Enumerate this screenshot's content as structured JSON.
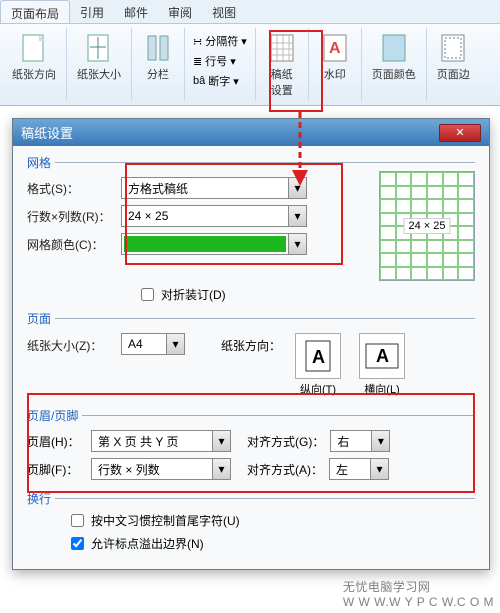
{
  "ribbon": {
    "tabs": [
      "页面布局",
      "引用",
      "邮件",
      "审阅",
      "视图"
    ],
    "active_tab": 0,
    "tools": {
      "paper_dir": "纸张方向",
      "paper_size": "纸张大小",
      "columns": "分栏",
      "breaks": "分隔符",
      "line_num": "行号",
      "hyphen": "断字",
      "manuscript": "稿纸",
      "manuscript_sub": "设置",
      "watermark": "水印",
      "page_color": "页面颜色",
      "page_border": "页面边"
    }
  },
  "dialog": {
    "title": "稿纸设置",
    "grid_section": "网格",
    "format_label": "格式(S)：",
    "format_value": "方格式稿纸",
    "rowcol_label": "行数×列数(R)：",
    "rowcol_value": "24 × 25",
    "gridcolor_label": "网格颜色(C)：",
    "preview_label": "24 × 25",
    "fold_label": "对折装订(D)",
    "page_section": "页面",
    "papersize_label": "纸张大小(Z)：",
    "papersize_value": "A4",
    "paperdir_label": "纸张方向：",
    "portrait": "纵向(T)",
    "landscape": "横向(L)",
    "hf_section": "页眉/页脚",
    "header_label": "页眉(H)：",
    "header_value": "第 X 页 共 Y 页",
    "header_align_label": "对齐方式(G)：",
    "header_align_value": "右",
    "footer_label": "页脚(F)：",
    "footer_value": "行数 × 列数",
    "footer_align_label": "对齐方式(A)：",
    "footer_align_value": "左",
    "wrap_section": "换行",
    "cjk_label": "按中文习惯控制首尾字符(U)",
    "punct_label": "允许标点溢出边界(N)"
  },
  "watermark": "无忧电脑学习网\nwww.wypcw.com"
}
